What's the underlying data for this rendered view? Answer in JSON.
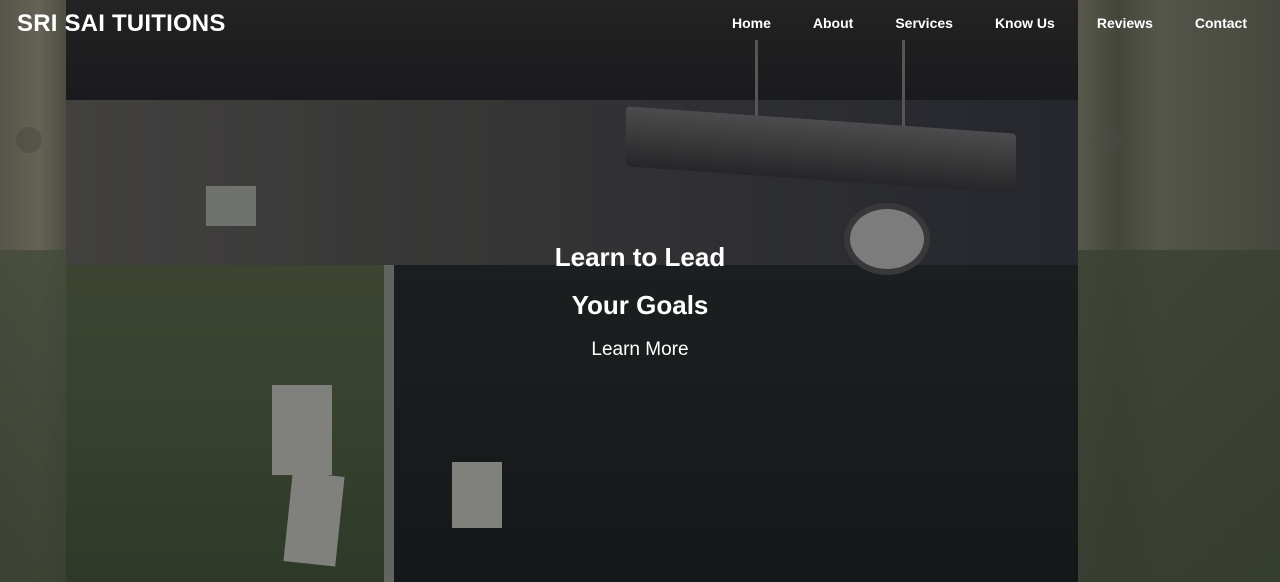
{
  "brand": {
    "name": "SRI SAI TUITIONS"
  },
  "nav": {
    "items": [
      "Home",
      "About",
      "Services",
      "Know Us",
      "Reviews",
      "Contact"
    ]
  },
  "hero": {
    "title_line1": "Learn to Lead",
    "title_line2": "Your Goals",
    "cta_label": "Learn More",
    "background": "classroom-photo"
  }
}
